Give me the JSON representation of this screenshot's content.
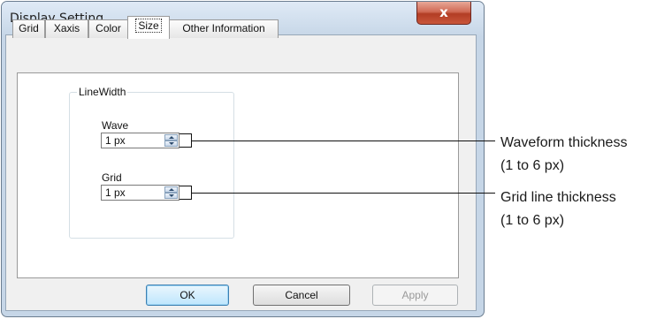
{
  "window": {
    "title": "Display Setting",
    "close_glyph": "x"
  },
  "tabs": [
    {
      "label": "Grid",
      "active": false
    },
    {
      "label": "Xaxis",
      "active": false
    },
    {
      "label": "Color",
      "active": false
    },
    {
      "label": "Size",
      "active": true
    },
    {
      "label": "Other Information",
      "active": false
    }
  ],
  "linewidth_group": {
    "legend": "LineWidth",
    "wave": {
      "label": "Wave",
      "value": "1 px"
    },
    "grid": {
      "label": "Grid",
      "value": "1 px"
    }
  },
  "buttons": {
    "ok": "OK",
    "cancel": "Cancel",
    "apply": "Apply"
  },
  "annotations": {
    "wave_line1": "Waveform thickness",
    "wave_line2": "(1 to 6 px)",
    "grid_line1": "Grid line thickness",
    "grid_line2": "(1 to 6 px)"
  },
  "colors": {
    "window_frame": "#c6d6e7",
    "close_button": "#c9563b",
    "default_button": "#bee6fd"
  }
}
